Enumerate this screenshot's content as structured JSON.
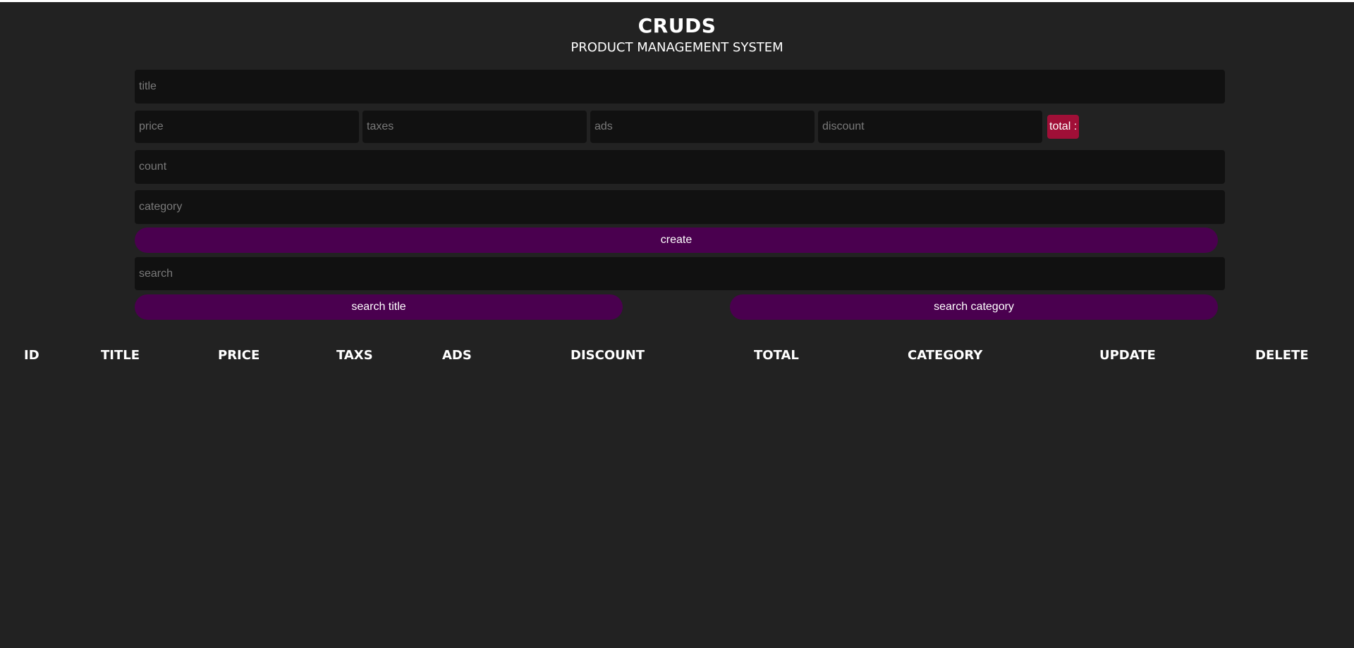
{
  "header": {
    "title": "CRUDS",
    "subtitle": "PRODUCT MANAGEMENT SYSTEM"
  },
  "form": {
    "title_placeholder": "title",
    "price_placeholder": "price",
    "taxes_placeholder": "taxes",
    "ads_placeholder": "ads",
    "discount_placeholder": "discount",
    "total_label": "total :",
    "count_placeholder": "count",
    "category_placeholder": "category",
    "create_label": "create"
  },
  "search": {
    "placeholder": "search",
    "by_title_label": "search title",
    "by_category_label": "search category"
  },
  "table": {
    "columns": [
      "ID",
      "TITLE",
      "PRICE",
      "TAXS",
      "ADS",
      "DISCOUNT",
      "TOTAL",
      "CATEGORY",
      "UPDATE",
      "DELETE"
    ]
  },
  "colors": {
    "background": "#222222",
    "input_background": "#111111",
    "button_purple": "#4a004f",
    "total_badge": "#a00f37"
  }
}
